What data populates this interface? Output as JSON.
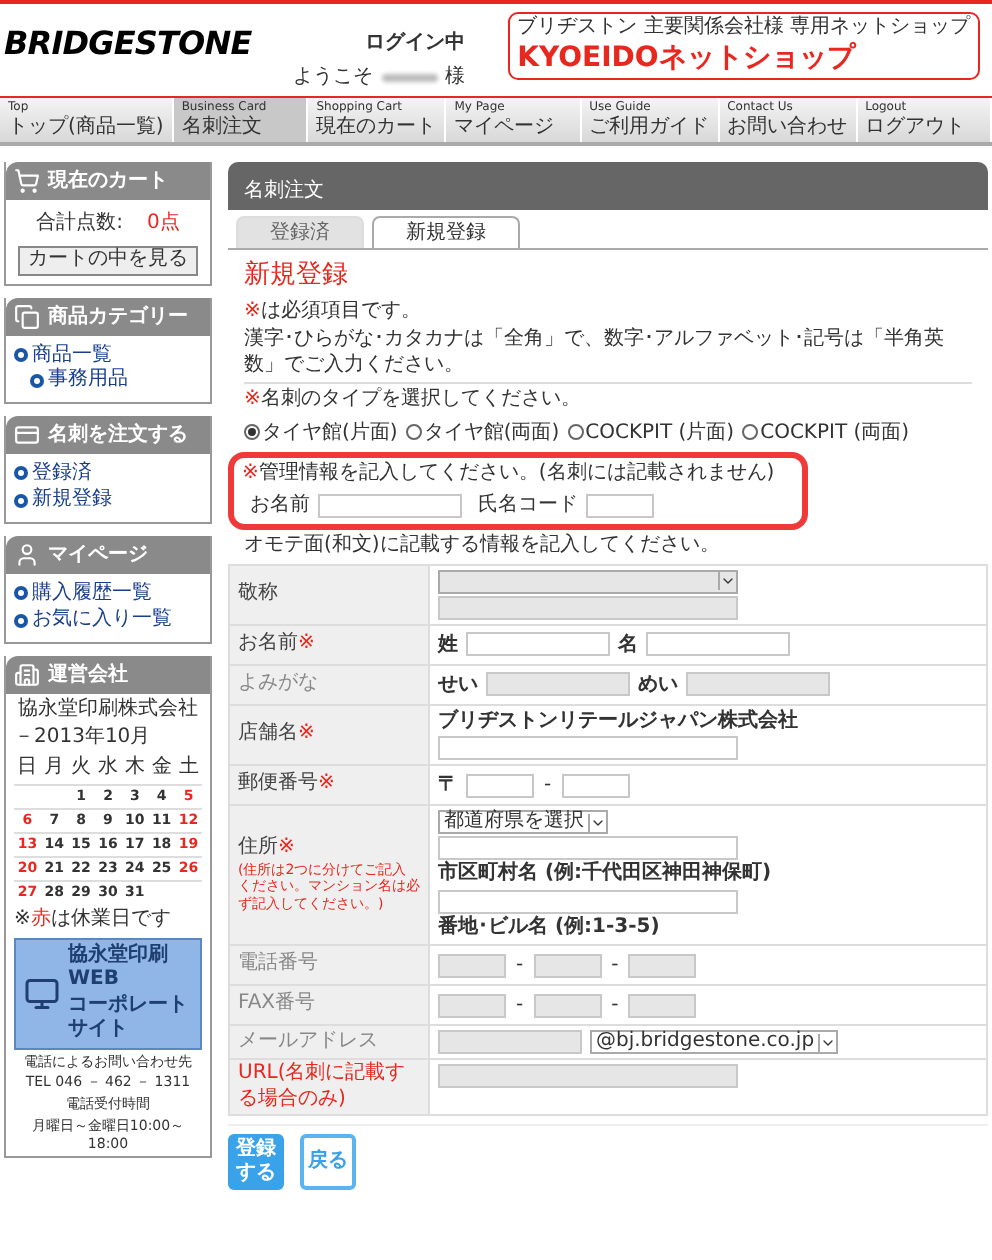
{
  "header": {
    "logo": "BRIDGESTONE",
    "login_status": "ログイン中",
    "welcome": "ようこそ",
    "honorific": "様",
    "shop_tagline": "ブリヂストン 主要関係会社様 専用ネットショップ",
    "shop_name": "KYOEIDOネットショップ"
  },
  "nav": [
    {
      "en": "Top",
      "ja": "トップ(商品一覧)",
      "selected": false
    },
    {
      "en": "Business Card",
      "ja": "名刺注文",
      "selected": true
    },
    {
      "en": "Shopping Cart",
      "ja": "現在のカート",
      "selected": false
    },
    {
      "en": "My Page",
      "ja": "マイページ",
      "selected": false
    },
    {
      "en": "Use Guide",
      "ja": "ご利用ガイド",
      "selected": false
    },
    {
      "en": "Contact Us",
      "ja": "お問い合わせ",
      "selected": false
    },
    {
      "en": "Logout",
      "ja": "ログアウト",
      "selected": false
    }
  ],
  "sidebar": {
    "cart": {
      "title": "現在のカート",
      "total_label": "合計点数:",
      "total_value": "0点",
      "button": "カートの中を見る"
    },
    "panels": [
      {
        "kind": "categories",
        "title": "商品カテゴリー",
        "links": [
          {
            "label": "商品一覧",
            "children": [
              {
                "label": "事務用品"
              }
            ]
          }
        ]
      },
      {
        "kind": "order",
        "title": "名刺を注文する",
        "links": [
          {
            "label": "登録済"
          },
          {
            "label": "新規登録"
          }
        ]
      },
      {
        "kind": "mypage",
        "title": "マイページ",
        "links": [
          {
            "label": "購入履歴一覧"
          },
          {
            "label": "お気に入り一覧"
          }
        ]
      }
    ],
    "company": {
      "title": "運営会社",
      "name": "協永堂印刷株式会社",
      "month": "－2013年10月",
      "weekdays": [
        {
          "label": "日",
          "holiday": false
        },
        {
          "label": "月",
          "holiday": false
        },
        {
          "label": "火",
          "holiday": false
        },
        {
          "label": "水",
          "holiday": false
        },
        {
          "label": "木",
          "holiday": false
        },
        {
          "label": "金",
          "holiday": false
        },
        {
          "label": "土",
          "holiday": false
        }
      ],
      "weeks": [
        {
          "align_end": true,
          "days": [
            {
              "day": "1",
              "holiday": false
            },
            {
              "day": "2",
              "holiday": false
            },
            {
              "day": "3",
              "holiday": false
            },
            {
              "day": "4",
              "holiday": false
            },
            {
              "day": "5",
              "holiday": true
            }
          ]
        },
        {
          "align_end": false,
          "days": [
            {
              "day": "6",
              "holiday": true
            },
            {
              "day": "7",
              "holiday": false
            },
            {
              "day": "8",
              "holiday": false
            },
            {
              "day": "9",
              "holiday": false
            },
            {
              "day": "10",
              "holiday": false
            },
            {
              "day": "11",
              "holiday": false
            },
            {
              "day": "12",
              "holiday": true
            }
          ]
        },
        {
          "align_end": false,
          "days": [
            {
              "day": "13",
              "holiday": true
            },
            {
              "day": "14",
              "holiday": false
            },
            {
              "day": "15",
              "holiday": false
            },
            {
              "day": "16",
              "holiday": false
            },
            {
              "day": "17",
              "holiday": false
            },
            {
              "day": "18",
              "holiday": false
            },
            {
              "day": "19",
              "holiday": true
            }
          ]
        },
        {
          "align_end": false,
          "days": [
            {
              "day": "20",
              "holiday": true
            },
            {
              "day": "21",
              "holiday": false
            },
            {
              "day": "22",
              "holiday": false
            },
            {
              "day": "23",
              "holiday": false
            },
            {
              "day": "24",
              "holiday": false
            },
            {
              "day": "25",
              "holiday": false
            },
            {
              "day": "26",
              "holiday": true
            }
          ]
        },
        {
          "align_end": false,
          "days": [
            {
              "day": "27",
              "holiday": true
            },
            {
              "day": "28",
              "holiday": false
            },
            {
              "day": "29",
              "holiday": false
            },
            {
              "day": "30",
              "holiday": false
            },
            {
              "day": "31",
              "holiday": false
            }
          ]
        }
      ],
      "legend": {
        "prefix": "※",
        "highlight": "赤",
        "rest": "は休業日です"
      },
      "banner": {
        "line1": "協永堂印刷 WEB",
        "line2": "コーポレートサイト"
      },
      "contact": [
        "電話によるお問い合わせ先",
        "TEL 046 － 462 － 1311",
        "電話受付時間",
        "月曜日～金曜日10:00～18:00"
      ]
    }
  },
  "main": {
    "title": "名刺注文",
    "tabs": [
      {
        "label": "登録済",
        "selected": false
      },
      {
        "label": "新規登録",
        "selected": true
      }
    ],
    "heading": "新規登録",
    "required_note": {
      "mark": "※",
      "text": "は必須項目です。"
    },
    "input_note": "漢字･ひらがな･カタカナは「全角」で、数字･アルファベット･記号は「半角英数」でご入力ください。",
    "type_prompt": {
      "mark": "※",
      "text": "名刺のタイプを選択してください。"
    },
    "card_types": [
      {
        "label": "タイヤ館(片面)",
        "selected": true
      },
      {
        "label": "タイヤ館(両面)",
        "selected": false
      },
      {
        "label": "COCKPIT (片面)",
        "selected": false
      },
      {
        "label": "COCKPIT (両面)",
        "selected": false
      }
    ],
    "admin": {
      "mark": "※",
      "prompt": "管理情報を記入してください。(名刺には記載されません)",
      "fields": [
        {
          "label": "お名前",
          "kind": "short_field"
        },
        {
          "label": "氏名コード",
          "kind": "tiny_field"
        }
      ]
    },
    "front_prompt": "オモテ面(和文)に記載する情報を記入してください。",
    "form": [
      {
        "label": "敬称",
        "disabled": false,
        "highlight": false,
        "lines": [
          [
            {
              "kind": "select",
              "disabled": true
            }
          ],
          [
            {
              "kind": "field",
              "disabled": true
            }
          ]
        ]
      },
      {
        "label": "お名前",
        "mark": "※",
        "disabled": false,
        "highlight": false,
        "lines": [
          [
            {
              "kind": "prefix",
              "text": "姓"
            },
            {
              "kind": "short_field",
              "disabled": false
            },
            {
              "kind": "prefix",
              "text": "名"
            },
            {
              "kind": "short_field",
              "disabled": false
            }
          ]
        ]
      },
      {
        "label": "よみがな",
        "disabled": true,
        "highlight": false,
        "lines": [
          [
            {
              "kind": "prefix",
              "text": "せい"
            },
            {
              "kind": "short_field",
              "disabled": true
            },
            {
              "kind": "prefix",
              "text": "めい"
            },
            {
              "kind": "short_field",
              "disabled": true
            }
          ]
        ]
      },
      {
        "label": "店舗名",
        "mark": "※",
        "disabled": false,
        "highlight": false,
        "lines": [
          [
            {
              "kind": "caption",
              "text": "ブリヂストンリテールジャパン株式会社"
            }
          ],
          [
            {
              "kind": "field",
              "disabled": false
            }
          ]
        ]
      },
      {
        "label": "郵便番号",
        "mark": "※",
        "disabled": false,
        "highlight": false,
        "lines": [
          [
            {
              "kind": "prefix",
              "text": "〒"
            },
            {
              "kind": "tiny_field",
              "disabled": false
            },
            {
              "kind": "sep",
              "text": "-"
            },
            {
              "kind": "tiny_field",
              "disabled": false
            }
          ]
        ]
      },
      {
        "label": "住所",
        "mark": "※",
        "disabled": false,
        "highlight": false,
        "note": "(住所は2つに分けてご記入ください。マンション名は必ず記入してください。)",
        "lines": [
          [
            {
              "kind": "select",
              "value": "都道府県を選択",
              "disabled": false
            }
          ],
          [
            {
              "kind": "field",
              "disabled": false
            }
          ],
          [
            {
              "kind": "caption",
              "text": "市区町村名 (例:千代田区神田神保町)"
            }
          ],
          [
            {
              "kind": "field",
              "disabled": false
            }
          ],
          [
            {
              "kind": "caption",
              "text": "番地･ビル名 (例:1-3-5)"
            }
          ]
        ]
      },
      {
        "label": "電話番号",
        "disabled": true,
        "highlight": false,
        "lines": [
          [
            {
              "kind": "tiny_field",
              "disabled": true
            },
            {
              "kind": "sep",
              "text": "-"
            },
            {
              "kind": "tiny_field",
              "disabled": true
            },
            {
              "kind": "sep",
              "text": "-"
            },
            {
              "kind": "tiny_field",
              "disabled": true
            }
          ]
        ]
      },
      {
        "label": "FAX番号",
        "disabled": true,
        "highlight": false,
        "lines": [
          [
            {
              "kind": "tiny_field",
              "disabled": true
            },
            {
              "kind": "sep",
              "text": "-"
            },
            {
              "kind": "tiny_field",
              "disabled": true
            },
            {
              "kind": "sep",
              "text": "-"
            },
            {
              "kind": "tiny_field",
              "disabled": true
            }
          ]
        ]
      },
      {
        "label": "メールアドレス",
        "disabled": true,
        "highlight": false,
        "lines": [
          [
            {
              "kind": "short_field",
              "disabled": true
            },
            {
              "kind": "select",
              "value": "@bj.bridgestone.co.jp",
              "disabled": false
            }
          ]
        ]
      },
      {
        "label": "URL(名刺に記載する場合のみ)",
        "disabled": false,
        "highlight": true,
        "lines": [
          [
            {
              "kind": "field",
              "disabled": true
            }
          ]
        ]
      }
    ],
    "buttons": [
      {
        "label": "登録する",
        "kind": "primary"
      },
      {
        "label": "戻る",
        "kind": "secondary"
      }
    ]
  }
}
